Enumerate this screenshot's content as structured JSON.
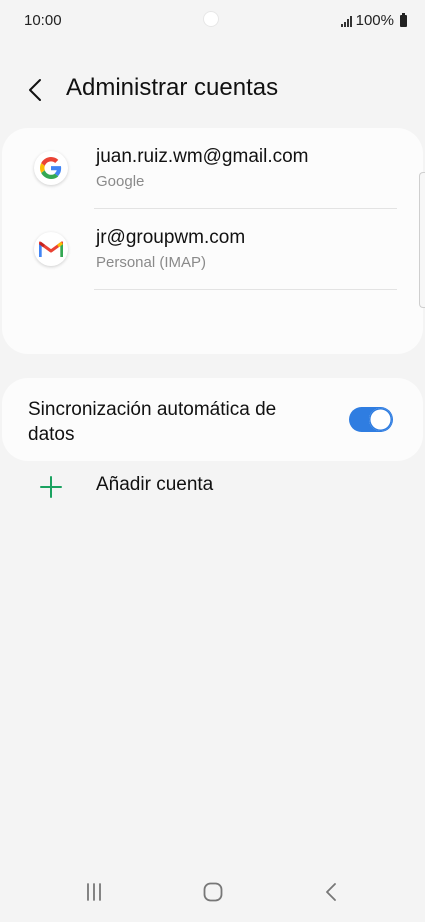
{
  "status_bar": {
    "time": "10:00",
    "battery": "100%"
  },
  "header": {
    "title": "Administrar cuentas",
    "back_icon": "chevron-left-icon"
  },
  "accounts": [
    {
      "email": "juan.ruiz.wm@gmail.com",
      "type": "Google",
      "icon": "google-icon"
    },
    {
      "email": "jr@groupwm.com",
      "type": "Personal (IMAP)",
      "icon": "gmail-icon"
    }
  ],
  "add_account": {
    "label": "Añadir cuenta",
    "icon": "plus-icon",
    "icon_color": "#1aa260"
  },
  "sync": {
    "label": "Sincronización automática de datos",
    "enabled": true,
    "toggle_color": "#2f7de1"
  },
  "nav": {
    "recents_icon": "recents-icon",
    "home_icon": "home-icon",
    "back_icon": "back-icon"
  }
}
